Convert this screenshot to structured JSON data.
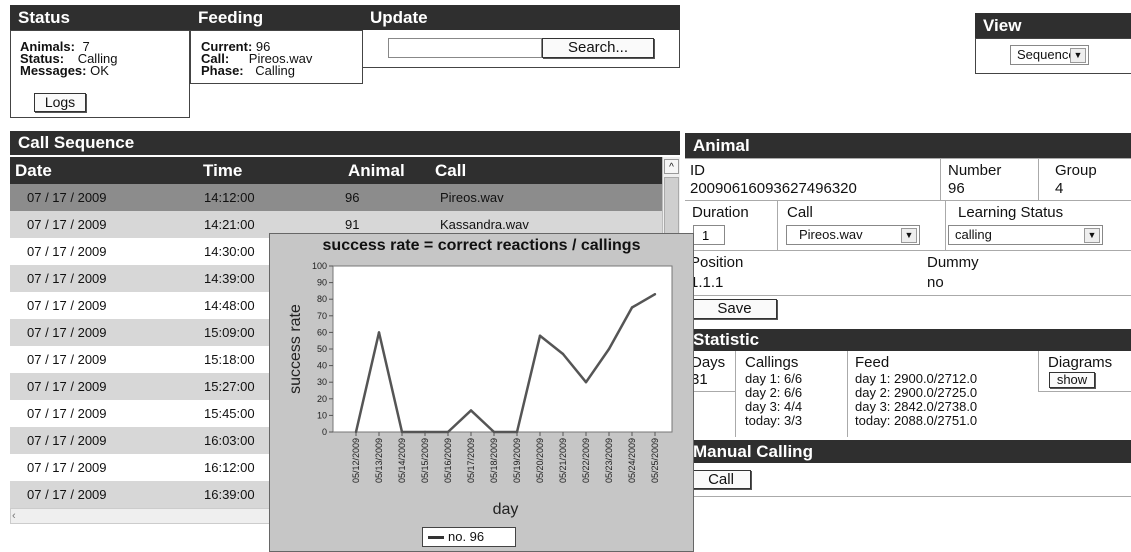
{
  "status": {
    "title": "Status",
    "animals_label": "Animals:",
    "animals_value": "7",
    "status_label": "Status:",
    "status_value": "Calling",
    "messages_label": "Messages:",
    "messages_value": "OK",
    "logs_button": "Logs"
  },
  "feeding": {
    "title": "Feeding",
    "current_label": "Current:",
    "current_value": "96",
    "call_label": "Call:",
    "call_value": "Pireos.wav",
    "phase_label": "Phase:",
    "phase_value": "Calling"
  },
  "update": {
    "title": "Update",
    "search_value": "",
    "search_button": "Search..."
  },
  "view": {
    "title": "View",
    "selected": "Sequence"
  },
  "call_sequence": {
    "title": "Call Sequence",
    "columns": [
      "Date",
      "Time",
      "Animal",
      "Call"
    ],
    "rows": [
      [
        "07 / 17 / 2009",
        "14:12:00",
        "96",
        "Pireos.wav"
      ],
      [
        "07 / 17 / 2009",
        "14:21:00",
        "91",
        "Kassandra.wav"
      ],
      [
        "07 / 17 / 2009",
        "14:30:00",
        "",
        ""
      ],
      [
        "07 / 17 / 2009",
        "14:39:00",
        "",
        ""
      ],
      [
        "07 / 17 / 2009",
        "14:48:00",
        "",
        ""
      ],
      [
        "07 / 17 / 2009",
        "15:09:00",
        "",
        ""
      ],
      [
        "07 / 17 / 2009",
        "15:18:00",
        "",
        ""
      ],
      [
        "07 / 17 / 2009",
        "15:27:00",
        "",
        ""
      ],
      [
        "07 / 17 / 2009",
        "15:45:00",
        "",
        ""
      ],
      [
        "07 / 17 / 2009",
        "16:03:00",
        "",
        ""
      ],
      [
        "07 / 17 / 2009",
        "16:12:00",
        "",
        ""
      ],
      [
        "07 / 17 / 2009",
        "16:39:00",
        "",
        ""
      ]
    ]
  },
  "animal": {
    "title": "Animal",
    "id_label": "ID",
    "id_value": "20090616093627496320",
    "number_label": "Number",
    "number_value": "96",
    "group_label": "Group",
    "group_value": "4",
    "duration_label": "Duration",
    "duration_value": "1",
    "call_label": "Call",
    "call_value": "Pireos.wav",
    "learning_label": "Learning Status",
    "learning_value": "calling",
    "position_label": "Position",
    "position_value": "1.1.1",
    "dummy_label": "Dummy",
    "dummy_value": "no",
    "save_button": "Save"
  },
  "statistic": {
    "title": "Statistic",
    "days_label": "Days",
    "days_value": "31",
    "callings_label": "Callings",
    "callings": [
      "day 1: 6/6",
      "day 2: 6/6",
      "day 3: 4/4",
      "today: 3/3"
    ],
    "feed_label": "Feed",
    "feed": [
      "day 1: 2900.0/2712.0",
      "day 2: 2900.0/2725.0",
      "day 3: 2842.0/2738.0",
      "today: 2088.0/2751.0"
    ],
    "diagrams_label": "Diagrams",
    "show_button": "show"
  },
  "manual_calling": {
    "title": "Manual Calling",
    "call_button": "Call"
  },
  "icons": {
    "scroll_up": "chevron-up-icon",
    "scroll_left": "chevron-left-icon",
    "dropdown": "chevron-down-icon"
  },
  "chart_data": {
    "type": "line",
    "title": "success rate = correct reactions / callings",
    "xlabel": "day",
    "ylabel": "success rate",
    "ylim": [
      0,
      100
    ],
    "yticks": [
      0,
      10,
      20,
      30,
      40,
      50,
      60,
      70,
      80,
      90,
      100
    ],
    "categories": [
      "05/12/2009",
      "05/13/2009",
      "05/14/2009",
      "05/15/2009",
      "05/16/2009",
      "05/17/2009",
      "05/18/2009",
      "05/19/2009",
      "05/20/2009",
      "05/21/2009",
      "05/22/2009",
      "05/23/2009",
      "05/24/2009",
      "05/25/2009"
    ],
    "series": [
      {
        "name": "no. 96",
        "values": [
          0,
          60,
          0,
          0,
          0,
          13,
          0,
          0,
          58,
          47,
          30,
          50,
          75,
          83
        ],
        "color": "#555555"
      }
    ],
    "grid": false,
    "legend": "bottom"
  }
}
